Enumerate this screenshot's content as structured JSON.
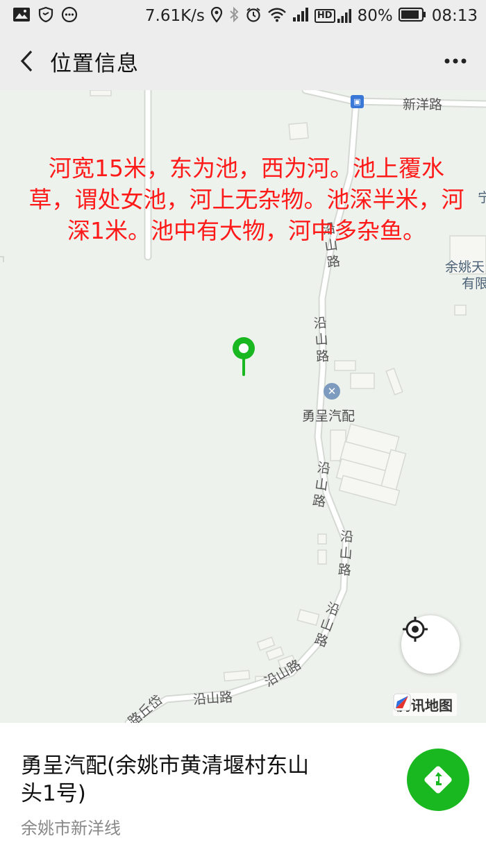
{
  "status_bar": {
    "speed": "7.61K/s",
    "battery": "80%",
    "time": "08:13",
    "hd_label": "HD"
  },
  "header": {
    "title": "位置信息"
  },
  "map": {
    "annotation": "河宽15米，东为池，西为河。池上覆水草，谓处女池，河上无杂物。池深半米，河深1米。池中有大物，河中多杂鱼。",
    "road_labels": {
      "xinyang": "新洋路",
      "yanshan_h1": "沿山路",
      "yanshan_h2": "沿山路",
      "yanshan_v1": "沿山路",
      "yanshan_v2": "沿山路",
      "yanshan_v3": "沿山路",
      "yanshan_v4": "沿山路",
      "yanshan_v5": "沿山路",
      "edge_road": "路丘岱"
    },
    "poi_label": "勇呈汽配",
    "edge_labels": {
      "company_line1": "余姚天",
      "company_line2": "有限",
      "edge_char": "宁"
    },
    "provider": "腾讯地图",
    "pin_color": "#1ab820"
  },
  "location": {
    "name": "勇呈汽配(余姚市黄清堰村东山头1号)",
    "address": "余姚市新洋线"
  }
}
